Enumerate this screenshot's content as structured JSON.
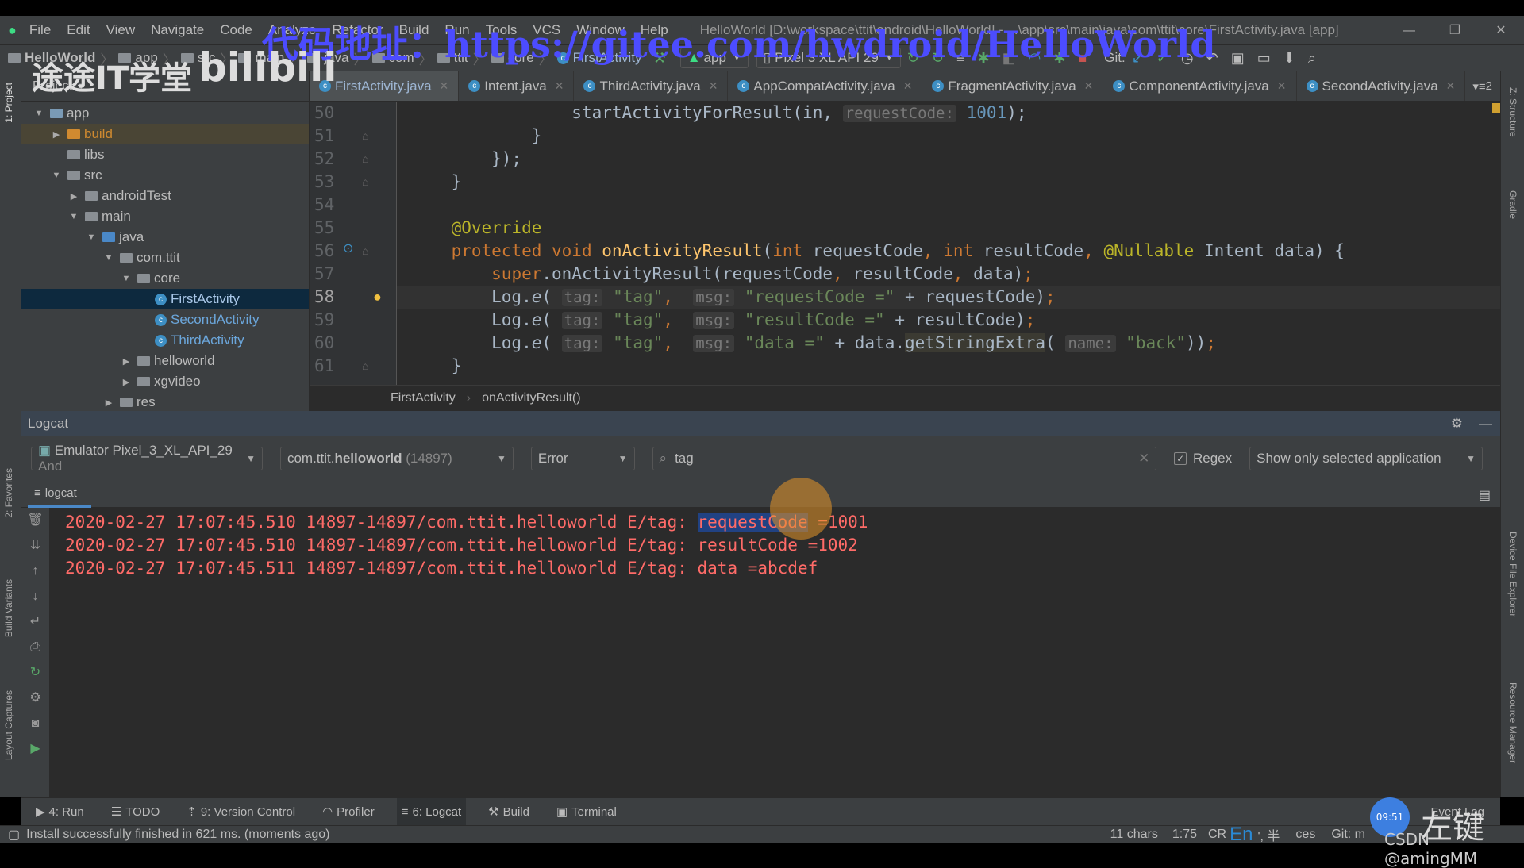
{
  "menu": {
    "items": [
      "File",
      "Edit",
      "View",
      "Navigate",
      "Code",
      "Analyze",
      "Refactor",
      "Build",
      "Run",
      "Tools",
      "VCS",
      "Window",
      "Help"
    ],
    "window_title": "HelloWorld [D:\\workspace\\ttit\\android\\HelloWorld] - ...\\app\\src\\main\\java\\com\\ttit\\core\\FirstActivity.java [app]"
  },
  "navbar": {
    "crumbs": [
      "HelloWorld",
      "app",
      "src",
      "main",
      "java",
      "com",
      "ttit",
      "core",
      "FirstActivity"
    ],
    "run_config": "app",
    "device": "Pixel 3 XL API 29",
    "git_label": "Git:"
  },
  "project": {
    "header": "Project",
    "tree": [
      {
        "label": "app",
        "depth": 0,
        "arrow": "▼",
        "type": "module"
      },
      {
        "label": "build",
        "depth": 1,
        "arrow": "▶",
        "type": "folder-orange"
      },
      {
        "label": "libs",
        "depth": 1,
        "arrow": "",
        "type": "folder"
      },
      {
        "label": "src",
        "depth": 1,
        "arrow": "▼",
        "type": "folder"
      },
      {
        "label": "androidTest",
        "depth": 2,
        "arrow": "▶",
        "type": "folder"
      },
      {
        "label": "main",
        "depth": 2,
        "arrow": "▼",
        "type": "folder"
      },
      {
        "label": "java",
        "depth": 3,
        "arrow": "▼",
        "type": "folder-blue"
      },
      {
        "label": "com.ttit",
        "depth": 4,
        "arrow": "▼",
        "type": "folder"
      },
      {
        "label": "core",
        "depth": 5,
        "arrow": "▼",
        "type": "folder"
      },
      {
        "label": "FirstActivity",
        "depth": 6,
        "arrow": "",
        "type": "class",
        "selected": true
      },
      {
        "label": "SecondActivity",
        "depth": 6,
        "arrow": "",
        "type": "class"
      },
      {
        "label": "ThirdActivity",
        "depth": 6,
        "arrow": "",
        "type": "class"
      },
      {
        "label": "helloworld",
        "depth": 5,
        "arrow": "▶",
        "type": "folder"
      },
      {
        "label": "xgvideo",
        "depth": 5,
        "arrow": "▶",
        "type": "folder"
      },
      {
        "label": "res",
        "depth": 4,
        "arrow": "▶",
        "type": "folder"
      }
    ]
  },
  "tabs": [
    {
      "label": "FirstActivity.java",
      "active": true
    },
    {
      "label": "Intent.java"
    },
    {
      "label": "ThirdActivity.java"
    },
    {
      "label": "AppCompatActivity.java"
    },
    {
      "label": "FragmentActivity.java"
    },
    {
      "label": "ComponentActivity.java"
    },
    {
      "label": "SecondActivity.java"
    }
  ],
  "tabs_overflow": "2",
  "editor": {
    "line_numbers": [
      "50",
      "51",
      "52",
      "53",
      "54",
      "55",
      "56",
      "57",
      "58",
      "59",
      "60",
      "61"
    ],
    "current_line": "58"
  },
  "breadcrumb": {
    "class": "FirstActivity",
    "method": "onActivityResult()"
  },
  "logcat": {
    "title": "Logcat",
    "device": "Emulator Pixel_3_XL_API_29",
    "device_suffix": "And",
    "process_pkg": "com.ttit.",
    "process_name": "helloworld",
    "process_pid": "(14897)",
    "level": "Error",
    "search": "tag",
    "regex_label": "Regex",
    "regex_checked": true,
    "filter": "Show only selected application",
    "subtab": "logcat",
    "lines": [
      {
        "prefix": "2020-02-27 17:07:45.510 14897-14897/com.ttit.helloworld E/tag: ",
        "selected": "requestCode",
        "rest": " =1001"
      },
      {
        "prefix": "2020-02-27 17:07:45.510 14897-14897/com.ttit.helloworld E/tag: ",
        "selected": "",
        "rest": "resultCode =1002"
      },
      {
        "prefix": "2020-02-27 17:07:45.511 14897-14897/com.ttit.helloworld E/tag: ",
        "selected": "",
        "rest": "data =abcdef"
      }
    ]
  },
  "toolwindows": [
    "4: Run",
    "TODO",
    "9: Version Control",
    "Profiler",
    "6: Logcat",
    "Build",
    "Terminal"
  ],
  "event_log": "Event Log",
  "status": {
    "message": "Install successfully finished in 621 ms. (moments ago)",
    "chars": "11 chars",
    "position": "1:75",
    "crlf": "CR",
    "ime": "En",
    "ime_extra": "', 半",
    "ces": "ces",
    "git": "Git: m"
  },
  "left_stripe": [
    "1: Project",
    "2: Favorites",
    "Build Variants",
    "Layout Captures"
  ],
  "right_stripe": [
    "Z: Structure",
    "Gradle",
    "Device File Explorer",
    "Resource Manager"
  ],
  "watermarks": {
    "gitee": "代码地址：https://gitee.com/hwdroid/HelloWorld",
    "brand": "途途IT学堂",
    "bili": "bilibili",
    "csdn": "CSDN @amingMM",
    "key": "左键",
    "clock": "09:51"
  },
  "colors": {
    "log_error": "#ff6b68",
    "keyword": "#cc7832",
    "string": "#6a8759",
    "selection": "#214283",
    "watermark": "#4c4cff"
  }
}
